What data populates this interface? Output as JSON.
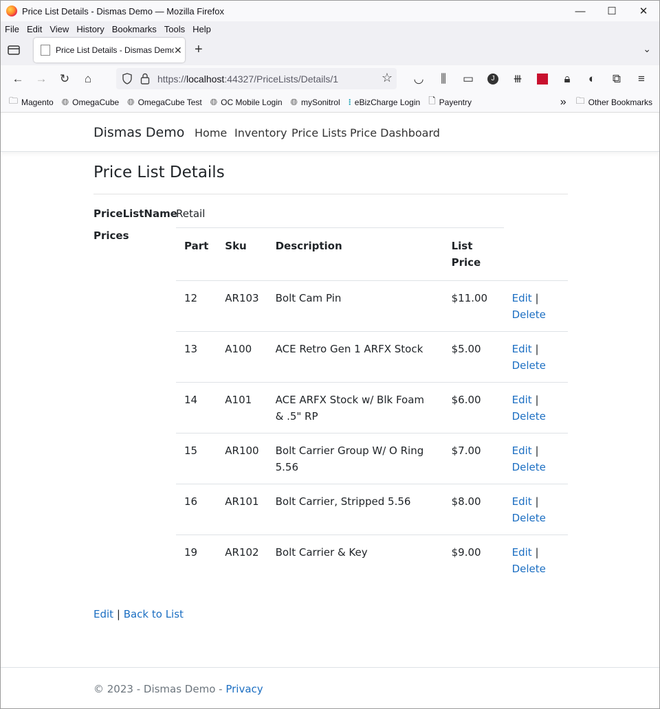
{
  "window": {
    "title": "Price List Details - Dismas Demo — Mozilla Firefox",
    "minimize": "—",
    "maximize": "☐",
    "close": "✕"
  },
  "menu": [
    "File",
    "Edit",
    "View",
    "History",
    "Bookmarks",
    "Tools",
    "Help"
  ],
  "tab": {
    "title": "Price List Details - Dismas Demo",
    "close": "✕",
    "new_tab": "+",
    "overflow": "⌄"
  },
  "address": {
    "scheme": "https://",
    "host": "localhost",
    "rest": ":44327/PriceLists/Details/1"
  },
  "bookmarks": {
    "items": [
      {
        "label": "Magento",
        "icon": "folder-icon"
      },
      {
        "label": "OmegaCube",
        "icon": "globe-icon"
      },
      {
        "label": "OmegaCube Test",
        "icon": "globe-icon"
      },
      {
        "label": "OC Mobile Login",
        "icon": "globe-icon"
      },
      {
        "label": "mySonitrol",
        "icon": "globe-icon"
      },
      {
        "label": "eBizCharge Login",
        "icon": "ebiz-icon"
      },
      {
        "label": "Payentry",
        "icon": "page-icon"
      }
    ],
    "other": "Other Bookmarks",
    "overflow": "»"
  },
  "site": {
    "brand": "Dismas Demo",
    "nav": [
      "Home",
      "Inventory",
      "Price Lists",
      "Price Dashboard"
    ]
  },
  "details": {
    "heading": "Price List Details",
    "name_label": "PriceListName",
    "name_value": "Retail",
    "prices_label": "Prices",
    "columns": {
      "part": "Part",
      "sku": "Sku",
      "description": "Description",
      "price_line1": "List",
      "price_line2": "Price"
    },
    "rows": [
      {
        "part": "12",
        "sku": "AR103",
        "description": "Bolt Cam Pin",
        "price": "$11.00"
      },
      {
        "part": "13",
        "sku": "A100",
        "description": "ACE Retro Gen 1 ARFX Stock",
        "price": "$5.00"
      },
      {
        "part": "14",
        "sku": "A101",
        "description": "ACE ARFX Stock w/ Blk Foam & .5\" RP",
        "price": "$6.00"
      },
      {
        "part": "15",
        "sku": "AR100",
        "description": "Bolt Carrier Group W/ O Ring 5.56",
        "price": "$7.00"
      },
      {
        "part": "16",
        "sku": "AR101",
        "description": "Bolt Carrier, Stripped 5.56",
        "price": "$8.00"
      },
      {
        "part": "19",
        "sku": "AR102",
        "description": "Bolt Carrier & Key",
        "price": "$9.00"
      }
    ],
    "row_edit": "Edit",
    "row_sep": "|",
    "row_delete": "Delete"
  },
  "bottom": {
    "edit": "Edit",
    "sep": "|",
    "back": "Back to List"
  },
  "footer": {
    "text": "© 2023 - Dismas Demo - ",
    "privacy": "Privacy"
  },
  "colors": {
    "link": "#1b6ec2",
    "text": "#212529",
    "muted": "#6c757d"
  }
}
